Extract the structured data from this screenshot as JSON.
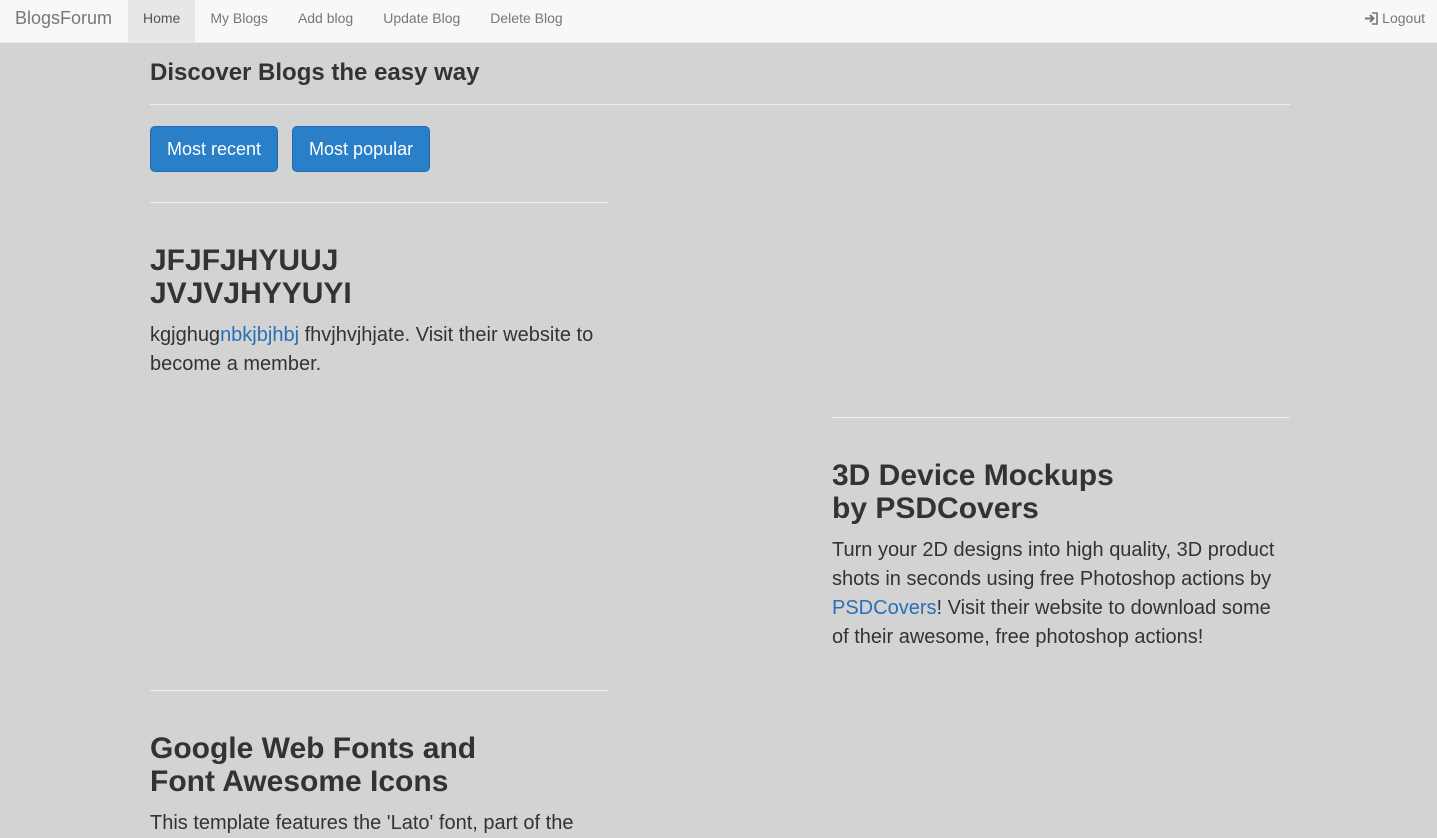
{
  "navbar": {
    "brand": "BlogsForum",
    "items": [
      {
        "label": "Home",
        "active": true
      },
      {
        "label": "My Blogs"
      },
      {
        "label": "Add blog"
      },
      {
        "label": "Update Blog"
      },
      {
        "label": "Delete Blog"
      }
    ],
    "logout_label": "Logout",
    "logout_icon": "log-in-icon"
  },
  "header": {
    "title": "Discover Blogs the easy way"
  },
  "buttons": {
    "most_recent": "Most recent",
    "most_popular": "Most popular"
  },
  "colors": {
    "background": "#d3d3d3",
    "navbar_bg": "#f8f8f8",
    "primary": "#2a7fc9",
    "link": "#2a6fb8",
    "text": "#333333"
  },
  "posts": [
    {
      "title_line1": "JFJFJHYUUJ",
      "title_line2": "JVJVJHYYUYI",
      "text_before": "kgjghug",
      "link_text": "nbkjbjhbj",
      "text_after": " fhvjhvjhjate. Visit their website to become a member."
    },
    {
      "title_line1": "3D Device Mockups",
      "title_line2": "by PSDCovers",
      "text_before": "Turn your 2D designs into high quality, 3D product shots in seconds using free Photoshop actions by ",
      "link_text": "PSDCovers",
      "text_after": "! Visit their website to download some of their awesome, free photoshop actions!"
    },
    {
      "title_line1": "Google Web Fonts and",
      "title_line2": "Font Awesome Icons",
      "text_before": "This template features the 'Lato' font, part of the",
      "link_text": "",
      "text_after": ""
    }
  ]
}
